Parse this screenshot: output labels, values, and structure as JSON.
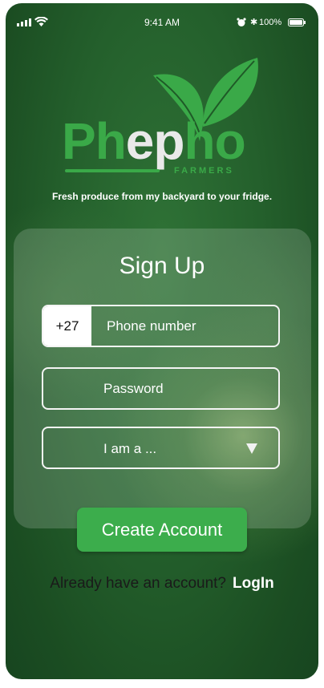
{
  "status_bar": {
    "time": "9:41 AM",
    "bluetooth_glyph": "✱",
    "battery_percent": "100%",
    "icons": [
      "signal-icon",
      "wifi-icon",
      "alarm-icon",
      "bluetooth-icon",
      "battery-icon"
    ]
  },
  "brand": {
    "name_part1": "Ph",
    "name_part2": "ep",
    "name_part3": "ho",
    "sub": "FARMERS",
    "tagline": "Fresh produce from my backyard to your fridge."
  },
  "form": {
    "title": "Sign Up",
    "phone_prefix": "+27",
    "phone_placeholder": "Phone number",
    "password_placeholder": "Password",
    "role_placeholder": "I am a ...",
    "submit_label": "Create Account"
  },
  "login": {
    "prompt": "Already have an account?",
    "link": "LogIn"
  },
  "colors": {
    "brand_green": "#3aa948",
    "button_green": "#3cad4c",
    "background": "#24602c"
  }
}
